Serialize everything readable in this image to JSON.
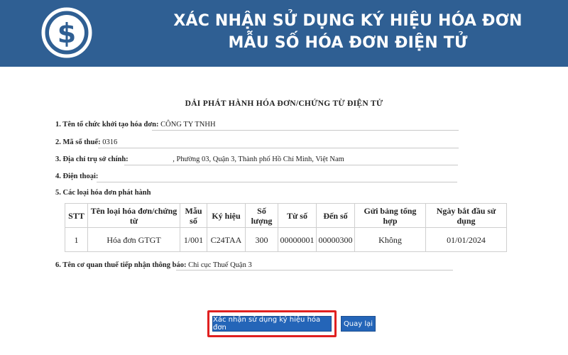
{
  "banner": {
    "title_line1": "XÁC NHẬN SỬ DỤNG KÝ HIỆU HÓA ĐƠN",
    "title_line2": "MẪU SỐ HÓA ĐƠN ĐIỆN TỬ",
    "logo_icon": "dollar-coin-icon",
    "color": "#2f5f93"
  },
  "document": {
    "title": "DẢI PHÁT HÀNH HÓA ĐƠN/CHỨNG TỪ ĐIỆN TỬ",
    "fields": {
      "org_label": "1. Tên tổ chức khởi tạo hóa đơn:",
      "org_value": "CÔNG TY TNHH",
      "tax_label": "2. Mã số thuế:",
      "tax_value": "0316",
      "address_label": "3. Địa chỉ trụ sở chính:",
      "address_value": ", Phường 03, Quận 3, Thành phố Hồ Chí Minh, Việt Nam",
      "phone_label": "4. Điện thoại:",
      "phone_value": "",
      "types_label": "5. Các loại hóa đơn phát hành",
      "authority_label": "6. Tên cơ quan thuế tiếp nhận thông báo:",
      "authority_value": "Chi cục Thuế Quận 3"
    },
    "table": {
      "headers": [
        "STT",
        "Tên loại hóa đơn/chứng từ",
        "Mẫu số",
        "Ký hiệu",
        "Số lượng",
        "Từ số",
        "Đến số",
        "Gửi bảng tổng hợp",
        "Ngày bắt đầu sử dụng"
      ],
      "rows": [
        [
          "1",
          "Hóa đơn GTGT",
          "1/001",
          "C24TAA",
          "300",
          "00000001",
          "00000300",
          "Không",
          "01/01/2024"
        ]
      ]
    }
  },
  "actions": {
    "confirm_label": "Xác nhận sử dụng ký hiệu hóa đơn",
    "back_label": "Quay lại",
    "highlight_color": "#e02020",
    "button_color": "#2465b8"
  }
}
